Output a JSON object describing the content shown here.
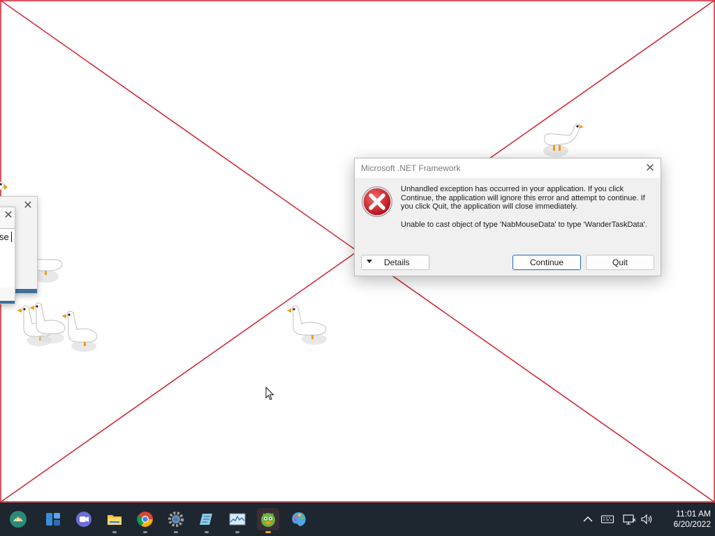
{
  "dialog": {
    "title": "Microsoft .NET Framework",
    "message_line1": "Unhandled exception has occurred in your application. If you click Continue, the application will ignore this error and attempt to continue. If you click Quit, the application will close immediately.",
    "message_line2": "Unable to cast object of type 'NabMouseData' to type 'WanderTaskData'.",
    "details_label": "Details",
    "continue_label": "Continue",
    "quit_label": "Quit",
    "close_glyph": "✕"
  },
  "mini_dialog": {
    "text": "se",
    "close_glyph": "✕"
  },
  "taskbar": {
    "apps": [
      {
        "name": "shell-icon"
      },
      {
        "name": "widgets-icon"
      },
      {
        "name": "teams-chat-icon"
      },
      {
        "name": "file-explorer-icon"
      },
      {
        "name": "chrome-icon"
      },
      {
        "name": "settings-gear-icon"
      },
      {
        "name": "notepad-icon"
      },
      {
        "name": "task-manager-icon"
      },
      {
        "name": "goose-app-icon",
        "active": true
      },
      {
        "name": "paint-icon"
      }
    ],
    "tray": [
      "chevron-up-icon",
      "keyboard-icon",
      "network-icon",
      "volume-icon"
    ],
    "time": "11:01 AM",
    "date": "6/20/2022"
  },
  "colors": {
    "cross_lines": "#d21f2b",
    "taskbar_bg": "#1e2630",
    "dialog_bg": "#f0f0f0",
    "accent_button_border": "#1f63b6"
  }
}
